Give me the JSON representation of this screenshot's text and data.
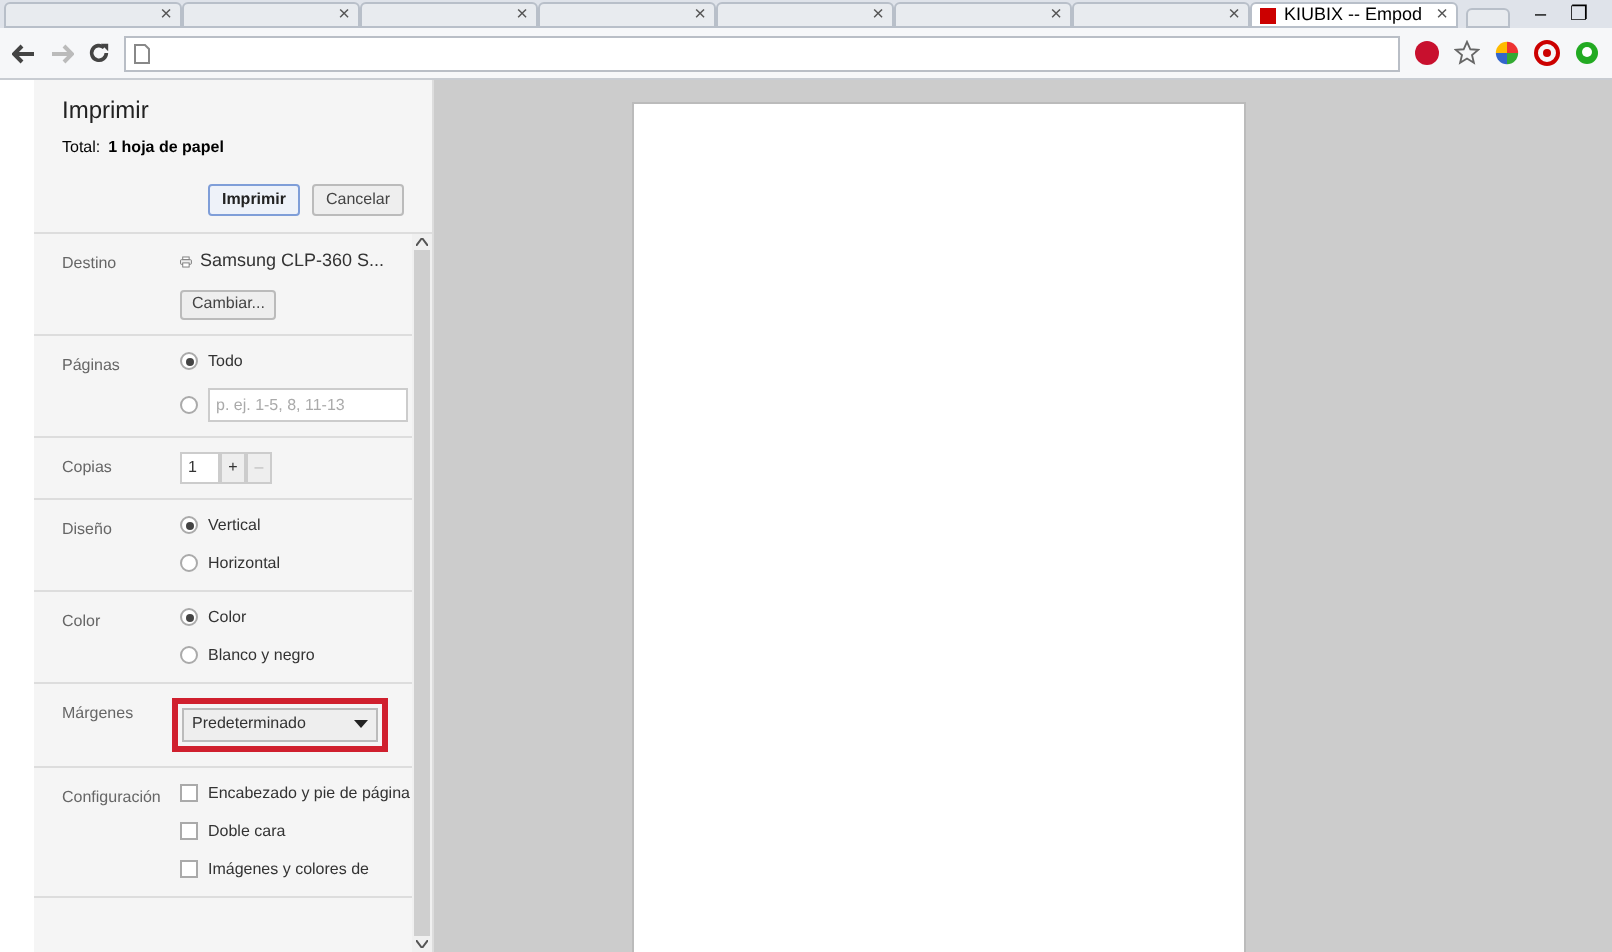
{
  "browser": {
    "tabs": [
      {
        "selected": false
      },
      {
        "selected": false
      },
      {
        "selected": false
      },
      {
        "selected": false
      },
      {
        "selected": false
      },
      {
        "selected": false
      },
      {
        "selected": false
      },
      {
        "title": "KIUBIX -- Empod",
        "selected": true
      }
    ],
    "close_glyph": "×",
    "window_controls": [
      "–",
      "❐"
    ]
  },
  "print": {
    "title": "Imprimir",
    "total_label": "Total:",
    "total_value": "1 hoja de papel",
    "buttons": [
      {
        "label": "Imprimir",
        "primary": true
      },
      {
        "label": "Cancelar",
        "primary": false
      }
    ],
    "sections": [
      {
        "kind": "destination",
        "label": "Destino",
        "printer": "Samsung CLP-360 S...",
        "button": "Cambiar..."
      },
      {
        "kind": "radio",
        "label": "Páginas",
        "options": [
          {
            "label": "Todo",
            "selected": true
          },
          {
            "placeholder": "p. ej. 1-5, 8, 11-13",
            "selected": false
          }
        ]
      },
      {
        "kind": "copies",
        "label": "Copias",
        "value": "1",
        "plus": "+",
        "minus": "–"
      },
      {
        "kind": "radio",
        "label": "Diseño",
        "options": [
          {
            "label": "Vertical",
            "selected": true
          },
          {
            "label": "Horizontal",
            "selected": false
          }
        ]
      },
      {
        "kind": "radio",
        "label": "Color",
        "options": [
          {
            "label": "Color",
            "selected": true
          },
          {
            "label": "Blanco y negro",
            "selected": false
          }
        ]
      },
      {
        "kind": "select",
        "label": "Márgenes",
        "value": "Predeterminado",
        "highlighted": true
      },
      {
        "kind": "checkbox",
        "label": "Configuración",
        "options": [
          {
            "label": "Encabezado y pie de página",
            "checked": false
          },
          {
            "label": "Doble cara",
            "checked": false
          },
          {
            "label": "Imágenes y colores de",
            "checked": false
          }
        ]
      }
    ]
  }
}
